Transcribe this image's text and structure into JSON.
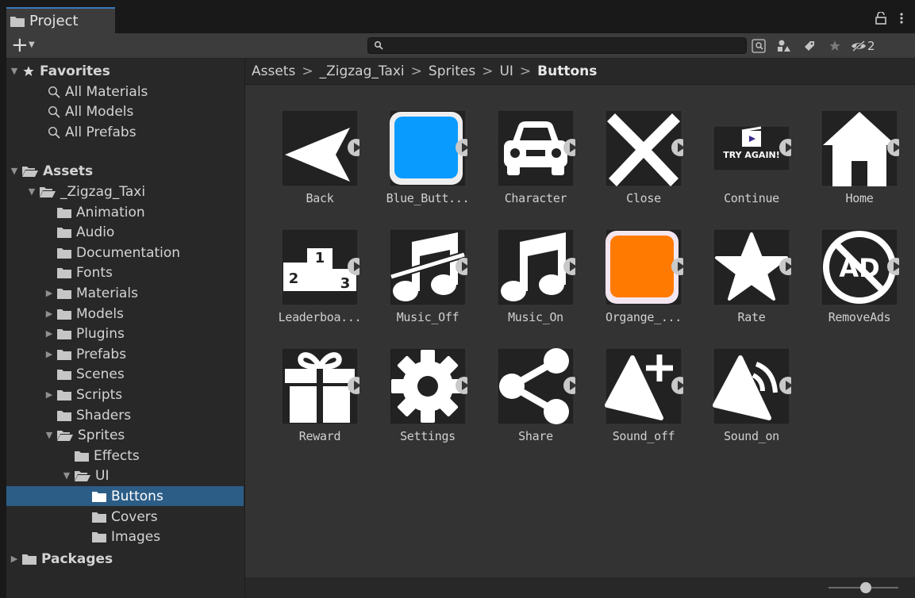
{
  "tab": {
    "title": "Project",
    "lock_icon": "lock-icon",
    "menu_icon": "kebab-menu-icon"
  },
  "toolbar": {
    "add_label": "+",
    "hidden_count": "2",
    "search_placeholder": ""
  },
  "sidebar": {
    "favorites": {
      "label": "Favorites",
      "items": [
        "All Materials",
        "All Models",
        "All Prefabs"
      ]
    },
    "assets_label": "Assets",
    "tree": [
      {
        "label": "_Zigzag_Taxi",
        "depth": 1,
        "arrow": "open",
        "folder": "open"
      },
      {
        "label": "Animation",
        "depth": 2,
        "arrow": "none",
        "folder": "closed"
      },
      {
        "label": "Audio",
        "depth": 2,
        "arrow": "none",
        "folder": "closed"
      },
      {
        "label": "Documentation",
        "depth": 2,
        "arrow": "none",
        "folder": "closed"
      },
      {
        "label": "Fonts",
        "depth": 2,
        "arrow": "none",
        "folder": "closed"
      },
      {
        "label": "Materials",
        "depth": 2,
        "arrow": "closed",
        "folder": "closed"
      },
      {
        "label": "Models",
        "depth": 2,
        "arrow": "closed",
        "folder": "closed"
      },
      {
        "label": "Plugins",
        "depth": 2,
        "arrow": "closed",
        "folder": "closed"
      },
      {
        "label": "Prefabs",
        "depth": 2,
        "arrow": "closed",
        "folder": "closed"
      },
      {
        "label": "Scenes",
        "depth": 2,
        "arrow": "none",
        "folder": "closed"
      },
      {
        "label": "Scripts",
        "depth": 2,
        "arrow": "closed",
        "folder": "closed"
      },
      {
        "label": "Shaders",
        "depth": 2,
        "arrow": "none",
        "folder": "closed"
      },
      {
        "label": "Sprites",
        "depth": 2,
        "arrow": "open",
        "folder": "open"
      },
      {
        "label": "Effects",
        "depth": 3,
        "arrow": "none",
        "folder": "closed"
      },
      {
        "label": "UI",
        "depth": 3,
        "arrow": "open",
        "folder": "open"
      },
      {
        "label": "Buttons",
        "depth": 4,
        "arrow": "none",
        "folder": "closed",
        "selected": true
      },
      {
        "label": "Covers",
        "depth": 4,
        "arrow": "none",
        "folder": "closed"
      },
      {
        "label": "Images",
        "depth": 4,
        "arrow": "none",
        "folder": "closed"
      }
    ],
    "packages_label": "Packages"
  },
  "breadcrumb": [
    "Assets",
    "_Zigzag_Taxi",
    "Sprites",
    "UI",
    "Buttons"
  ],
  "breadcrumb_separator": ">",
  "assets": [
    {
      "label": "Back",
      "icon": "back-arrow-icon"
    },
    {
      "label": "Blue_Butt...",
      "icon": "blue-button-icon"
    },
    {
      "label": "Character",
      "icon": "car-icon"
    },
    {
      "label": "Close",
      "icon": "close-x-icon"
    },
    {
      "label": "Continue",
      "icon": "try-again-icon"
    },
    {
      "label": "Home",
      "icon": "home-icon"
    },
    {
      "label": "Leaderboa...",
      "icon": "podium-icon"
    },
    {
      "label": "Music_Off",
      "icon": "music-off-icon"
    },
    {
      "label": "Music_On",
      "icon": "music-on-icon"
    },
    {
      "label": "Organge_...",
      "icon": "orange-button-icon"
    },
    {
      "label": "Rate",
      "icon": "star-icon"
    },
    {
      "label": "RemoveAds",
      "icon": "no-ads-icon"
    },
    {
      "label": "Reward",
      "icon": "gift-icon"
    },
    {
      "label": "Settings",
      "icon": "gear-icon"
    },
    {
      "label": "Share",
      "icon": "share-icon"
    },
    {
      "label": "Sound_off",
      "icon": "sound-off-icon"
    },
    {
      "label": "Sound_on",
      "icon": "sound-on-icon"
    }
  ],
  "podium_numbers": [
    "1",
    "2",
    "3"
  ],
  "try_again_text": "TRY AGAIN!",
  "ad_text": "AD",
  "colors": {
    "selection": "#2c5d87",
    "tab_accent": "#3a79bb",
    "blue_button": "#0a9bff",
    "orange_button": "#ff7a00"
  }
}
